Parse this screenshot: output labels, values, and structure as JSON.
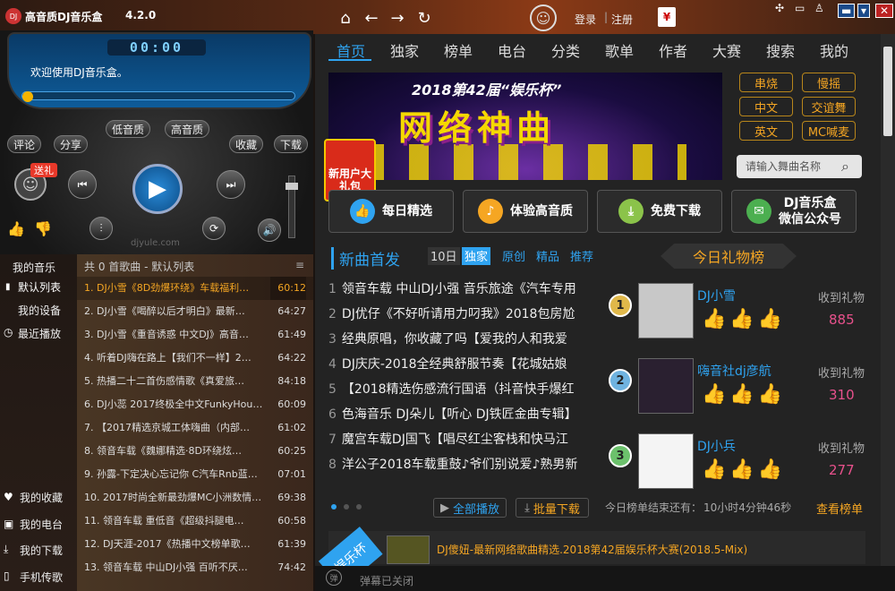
{
  "titlebar": {
    "logo_text": "DJ",
    "app_title": "高音质DJ音乐盒",
    "version": "4.2.0",
    "login": "登录",
    "separator": "|",
    "register": "注册",
    "wallet_icon": "¥"
  },
  "player": {
    "time": "00:00",
    "welcome": "欢迎使用DJ音乐盒。",
    "low_quality": "低音质",
    "high_quality": "高音质",
    "comment": "评论",
    "share": "分享",
    "favorite": "收藏",
    "download": "下载",
    "gift": "送礼",
    "watermark": "djyule.com",
    "progress": 0
  },
  "leftnav": {
    "my_music": "我的音乐",
    "default_list": "默认列表",
    "my_devices": "我的设备",
    "recent": "最近播放",
    "my_favorites": "我的收藏",
    "my_radio": "我的电台",
    "my_downloads": "我的下载",
    "phone_transfer": "手机传歌"
  },
  "playlist": {
    "header": "共 0 首歌曲 - 默认列表",
    "rows": [
      {
        "name": "1. DJ小雪《8D劲爆环绕》车载福利…",
        "time": "60:12"
      },
      {
        "name": "2. DJ小雪《喝醉以后才明白》最新…",
        "time": "64:27"
      },
      {
        "name": "3. DJ小雪《重音诱惑 中文DJ》高音…",
        "time": "61:49"
      },
      {
        "name": "4. 听着DJ嗨在路上【我们不一样】2…",
        "time": "64:22"
      },
      {
        "name": "5. 热播二十二首伤感情歌《真爱旅…",
        "time": "84:18"
      },
      {
        "name": "6. DJ小蕊 2017终极全中文FunkyHou…",
        "time": "60:09"
      },
      {
        "name": "7. 【2017精选京城工体嗨曲（内部…",
        "time": "61:02"
      },
      {
        "name": "8. 领音车载《魏娜精选·8D环绕炫…",
        "time": "60:25"
      },
      {
        "name": "9. 孙露-下定决心忘记你 C汽车Rnb蓝…",
        "time": "07:01"
      },
      {
        "name": "10. 2017时尚全新最劲爆MC小洲数情…",
        "time": "69:38"
      },
      {
        "name": "11. 领音车载 重低音《超级抖腿电…",
        "time": "60:58"
      },
      {
        "name": "12. DJ天涯-2017《热播中文榜单歌…",
        "time": "61:39"
      },
      {
        "name": "13. 领音车载 中山DJ小强 百听不厌…",
        "time": "74:42"
      }
    ]
  },
  "tabs": [
    "首页",
    "独家",
    "榜单",
    "电台",
    "分类",
    "歌单",
    "作者",
    "大赛",
    "搜索",
    "我的"
  ],
  "banner": {
    "subtitle": "2018第42届“娱乐杯”",
    "title": "网络神曲"
  },
  "new_user": "新用户大礼包",
  "tags": [
    "串烧",
    "慢摇",
    "中文",
    "交谊舞",
    "英文",
    "MC喊麦"
  ],
  "search": {
    "placeholder": "请输入舞曲名称"
  },
  "features": [
    {
      "label": "每日精选"
    },
    {
      "label": "体验高音质"
    },
    {
      "label": "免费下载"
    },
    {
      "label": "DJ音乐盒\n微信公众号"
    }
  ],
  "new_songs": {
    "title": "新曲首发",
    "filters": [
      "10日",
      "独家",
      "原创",
      "精品",
      "推荐"
    ],
    "songs": [
      {
        "n": "1",
        "t": "领音车载 中山DJ小强 音乐旅途《汽车专用"
      },
      {
        "n": "2",
        "t": "DJ优仔《不好听请用力叼我》2018包房尬"
      },
      {
        "n": "3",
        "t": "经典原唱，你收藏了吗【爱我的人和我爱"
      },
      {
        "n": "4",
        "t": "DJ庆庆-2018全经典舒服节奏【花城姑娘"
      },
      {
        "n": "5",
        "t": "【2018精选伤感流行国语（抖音快手爆红"
      },
      {
        "n": "6",
        "t": "色海音乐 DJ朵儿【听心 DJ铁匠金曲专辑】"
      },
      {
        "n": "7",
        "t": "魔宫车载DJ国飞【唱尽红尘客栈和快马江"
      },
      {
        "n": "8",
        "t": "洋公子2018车载重鼓♪爷们别说爱♪熟男新"
      }
    ],
    "play_all": "全部播放",
    "batch_download": "批量下载"
  },
  "gift_rank": {
    "title": "今日礼物榜",
    "received_label": "收到礼物",
    "entries": [
      {
        "rank": "1",
        "name": "DJ小雪",
        "gifts": 885
      },
      {
        "rank": "2",
        "name": "嗨音社dj彦航",
        "gifts": 310
      },
      {
        "rank": "3",
        "name": "DJ小兵",
        "gifts": 277
      }
    ],
    "end_label": "今日榜单结束还有：",
    "end_time": "10小时4分钟46秒",
    "view_rank": "查看榜单"
  },
  "entertainment": {
    "tag": "娱乐杯",
    "text": "DJ傻妞-最新网络歌曲精选.2018第42届娱乐杯大赛(2018.5-Mix)"
  },
  "status": {
    "danmu": "弹幕已关闭"
  }
}
